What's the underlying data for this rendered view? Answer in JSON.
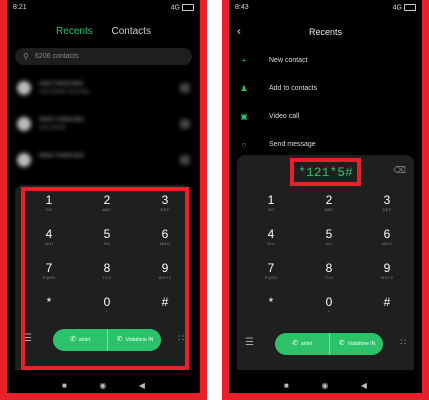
{
  "left_phone": {
    "status": {
      "time": "8:21",
      "network": "4G"
    },
    "tabs": {
      "recents": "Recents",
      "contacts": "Contacts"
    },
    "search": {
      "placeholder": "6206 contacts"
    },
    "contacts": [
      {
        "name": "Axel Friend Blue",
        "sub": "India Mobile Yesterday"
      },
      {
        "name": "Noon Friend Box",
        "sub": "India Mobile"
      },
      {
        "name": "Noon Friend Box",
        "sub": ""
      }
    ],
    "keys": [
      {
        "d": "1",
        "l": "GO"
      },
      {
        "d": "2",
        "l": "ABC"
      },
      {
        "d": "3",
        "l": "DEF"
      },
      {
        "d": "4",
        "l": "GHI"
      },
      {
        "d": "5",
        "l": "JKL"
      },
      {
        "d": "6",
        "l": "MNO"
      },
      {
        "d": "7",
        "l": "PQRS"
      },
      {
        "d": "8",
        "l": "TUV"
      },
      {
        "d": "9",
        "l": "WXYZ"
      },
      {
        "d": "*",
        "l": ","
      },
      {
        "d": "0",
        "l": "+"
      },
      {
        "d": "#",
        "l": ""
      }
    ],
    "call": {
      "sim1": "airtel",
      "sim2": "Vodafone IN"
    }
  },
  "right_phone": {
    "status": {
      "time": "8:43",
      "network": "4G"
    },
    "title": "Recents",
    "menu": [
      {
        "label": "New contact",
        "icon": "plus-icon"
      },
      {
        "label": "Add to contacts",
        "icon": "person-icon"
      },
      {
        "label": "Video call",
        "icon": "video-icon"
      },
      {
        "label": "Send message",
        "icon": "message-icon"
      }
    ],
    "ussd": "*121*5#",
    "keys": [
      {
        "d": "1",
        "l": "GO"
      },
      {
        "d": "2",
        "l": "ABC"
      },
      {
        "d": "3",
        "l": "DEF"
      },
      {
        "d": "4",
        "l": "GHI"
      },
      {
        "d": "5",
        "l": "JKL"
      },
      {
        "d": "6",
        "l": "MNO"
      },
      {
        "d": "7",
        "l": "PQRS"
      },
      {
        "d": "8",
        "l": "TUV"
      },
      {
        "d": "9",
        "l": "WXYZ"
      },
      {
        "d": "*",
        "l": ","
      },
      {
        "d": "0",
        "l": "+"
      },
      {
        "d": "#",
        "l": ""
      }
    ],
    "call": {
      "sim1": "airtel",
      "sim2": "Vodafone IN"
    }
  },
  "colors": {
    "frame": "#e8202a",
    "accent": "#2bc26a"
  }
}
